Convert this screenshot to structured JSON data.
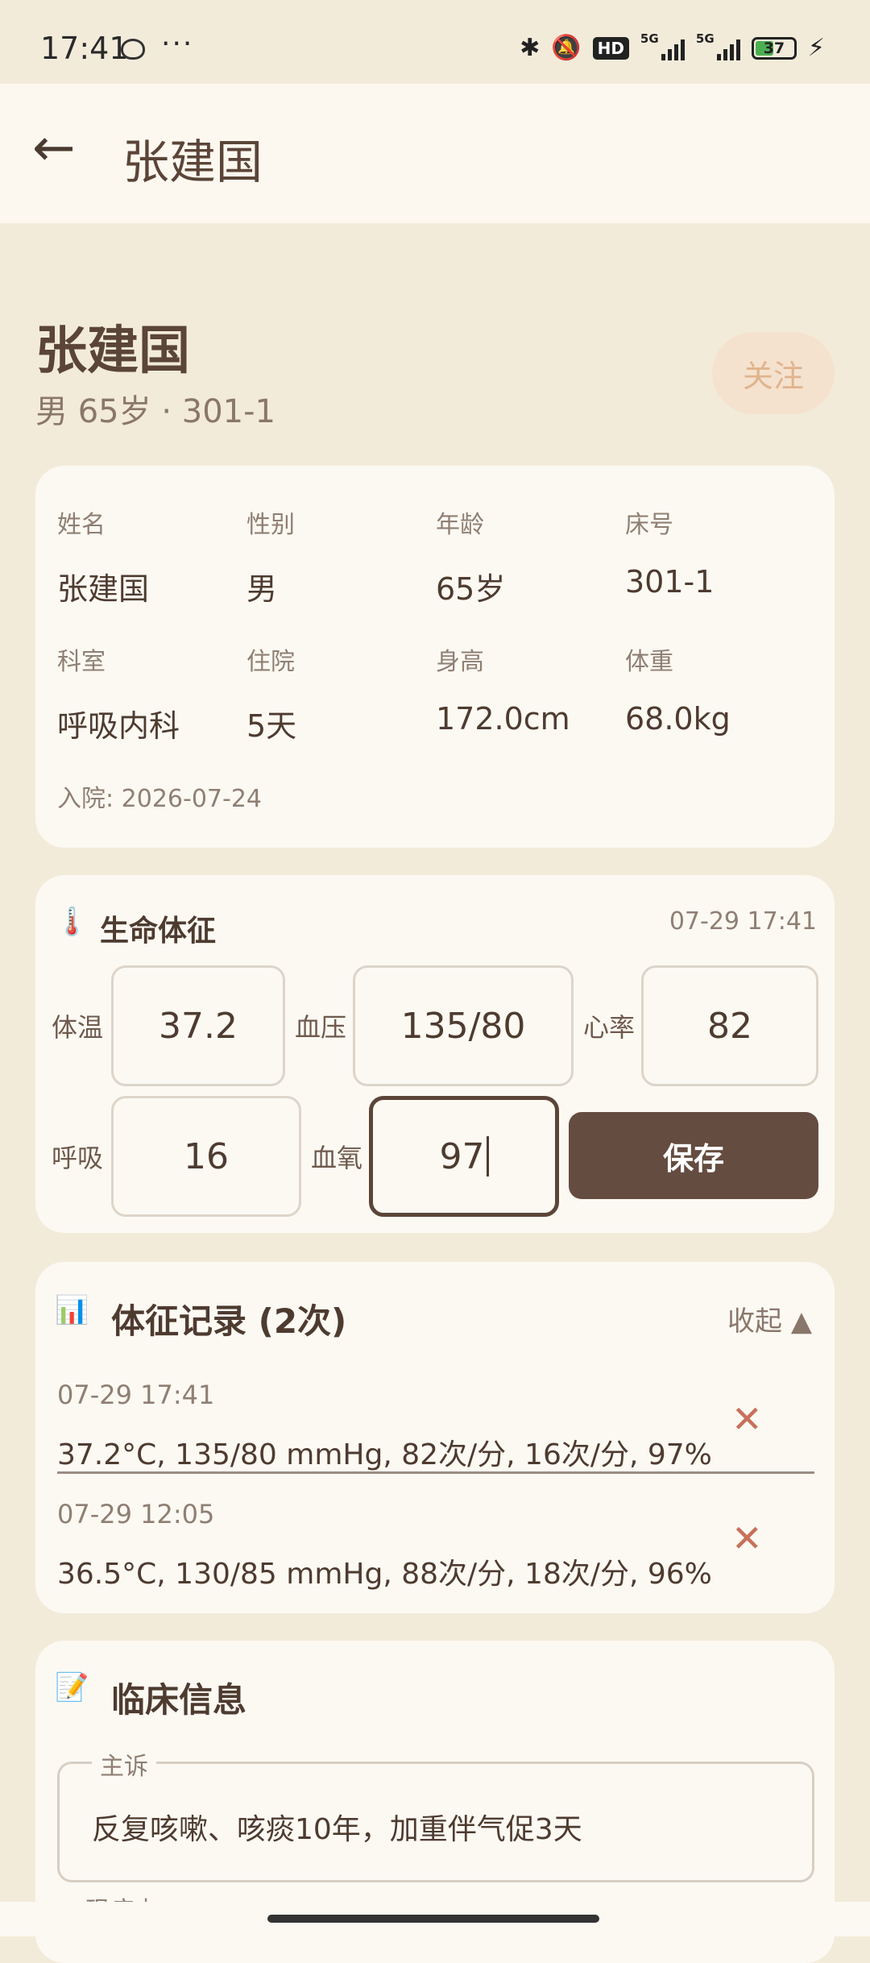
{
  "status_bar": {
    "time": "17:41",
    "dots": "···",
    "hd": "HD",
    "signal1": "5G",
    "signal2": "5G",
    "battery": "37"
  },
  "app_bar": {
    "title": "张建国"
  },
  "patient": {
    "name": "张建国",
    "subtitle": "男 65岁 · 301-1",
    "follow_label": "关注"
  },
  "info": {
    "fields": [
      {
        "label": "姓名",
        "value": "张建国"
      },
      {
        "label": "性别",
        "value": "男"
      },
      {
        "label": "年龄",
        "value": "65岁"
      },
      {
        "label": "床号",
        "value": "301-1"
      },
      {
        "label": "科室",
        "value": "呼吸内科"
      },
      {
        "label": "住院",
        "value": "5天"
      },
      {
        "label": "身高",
        "value": "172.0cm"
      },
      {
        "label": "体重",
        "value": "68.0kg"
      }
    ],
    "admission": "入院: 2026-07-24"
  },
  "vitals": {
    "icon": "🌡️",
    "title": "生命体征",
    "time": "07-29 17:41",
    "temp": {
      "label": "体温",
      "value": "37.2"
    },
    "bp": {
      "label": "血压",
      "value": "135/80"
    },
    "hr": {
      "label": "心率",
      "value": "82"
    },
    "resp": {
      "label": "呼吸",
      "value": "16"
    },
    "spo2": {
      "label": "血氧",
      "value": "97"
    },
    "save_label": "保存"
  },
  "records": {
    "icon": "📊",
    "title": "体征记录 (2次)",
    "collapse_label": "收起 ▲",
    "items": [
      {
        "time": "07-29 17:41",
        "value": "37.2°C, 135/80 mmHg, 82次/分, 16次/分, 97%"
      },
      {
        "time": "07-29 12:05",
        "value": "36.5°C, 130/85 mmHg, 88次/分, 18次/分, 96%"
      }
    ],
    "delete_glyph": "✕"
  },
  "clinical": {
    "icon": "📝",
    "title": "临床信息",
    "chief_complaint_label": "主诉",
    "chief_complaint_value": "反复咳嗽、咳痰10年，加重伴气促3天",
    "next_label": "现病史"
  }
}
